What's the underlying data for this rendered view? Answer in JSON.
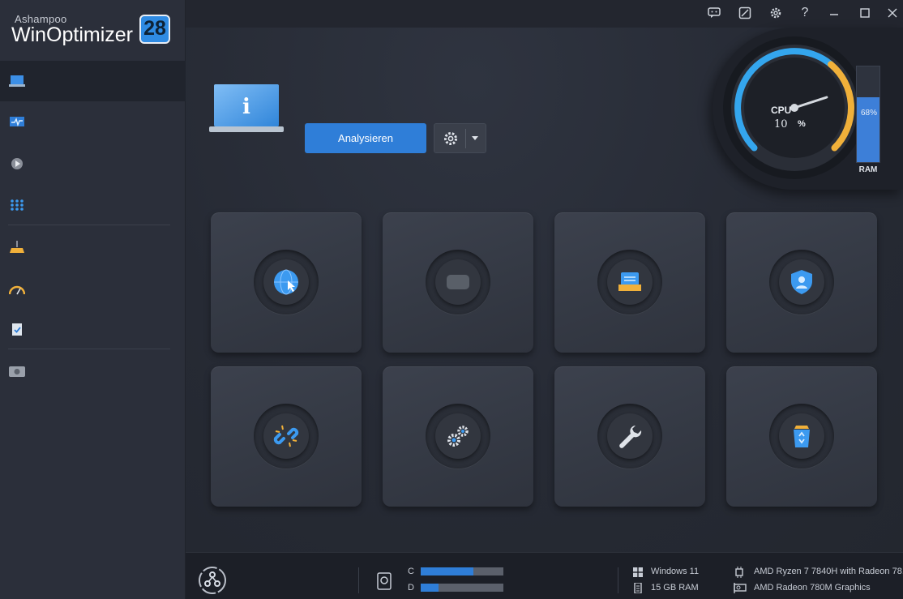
{
  "brand": {
    "vendor": "Ashampoo",
    "product": "WinOptimizer",
    "version": "28"
  },
  "sidebar": {
    "items": [
      {
        "id": "overview",
        "icon": "laptop-icon",
        "active": true
      },
      {
        "id": "monitor",
        "icon": "pulse-monitor-icon",
        "active": false
      },
      {
        "id": "performance",
        "icon": "gear-play-icon",
        "active": false
      },
      {
        "id": "all-modules",
        "icon": "grid-dots-icon",
        "active": false
      },
      {
        "id": "cleaner",
        "icon": "broom-icon",
        "active": false
      },
      {
        "id": "tuning",
        "icon": "speedometer-icon",
        "active": false
      },
      {
        "id": "tasks",
        "icon": "clipboard-check-icon",
        "active": false
      },
      {
        "id": "backups",
        "icon": "drive-icon",
        "active": false
      }
    ]
  },
  "titlebar": {
    "icons": [
      "feedback-icon",
      "skin-icon",
      "settings-icon",
      "help-icon",
      "minimize-icon",
      "maximize-icon",
      "close-icon"
    ]
  },
  "main": {
    "analyze_label": "Analysieren",
    "options_icon": "gear-icon"
  },
  "cpu": {
    "label": "CPU",
    "value": "10",
    "unit": "%",
    "fraction": 0.1
  },
  "ram": {
    "label": "RAM",
    "percent_text": "68%",
    "fraction": 0.68
  },
  "tiles": [
    {
      "icon": "globe-cursor-icon"
    },
    {
      "icon": "blurred-icon"
    },
    {
      "icon": "drive-tray-icon"
    },
    {
      "icon": "shield-user-icon"
    },
    {
      "icon": "broken-link-icon"
    },
    {
      "icon": "gears-icon"
    },
    {
      "icon": "wrench-icon"
    },
    {
      "icon": "recycle-bin-icon"
    }
  ],
  "status": {
    "drives": [
      {
        "label": "C",
        "fraction": 0.64
      },
      {
        "label": "D",
        "fraction": 0.22
      }
    ],
    "os": "Windows 11",
    "ram": "15 GB RAM",
    "cpu": "AMD Ryzen 7 7840H with Radeon 78...",
    "gpu": "AMD Radeon 780M Graphics"
  },
  "colors": {
    "accent": "#2f7ed8",
    "gauge_warm": "#f0b03a",
    "gauge_cool": "#34a6ee"
  }
}
